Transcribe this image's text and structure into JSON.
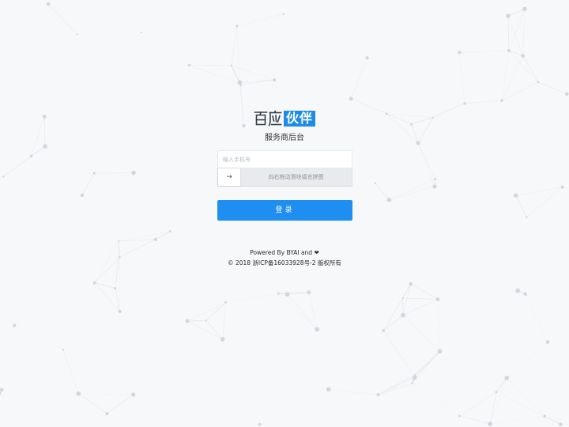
{
  "logo": {
    "part_a": "百应",
    "part_b": "伙伴",
    "accent_color": "#1e8ce6"
  },
  "subtitle": "服务商后台",
  "phone_input": {
    "placeholder": "输入手机号",
    "value": ""
  },
  "slider_captcha": {
    "handle_icon": "arrow-right-icon",
    "handle_glyph": "→",
    "hint": "向右拖动滑块填充拼图"
  },
  "login_button": {
    "label": "登录",
    "color": "#1e8ef0"
  },
  "footer": {
    "powered_by": "Powered By BYAI and",
    "heart_glyph": "❤",
    "heart_icon": "heart-icon",
    "copyright": "© 2018 浙ICP备16033928号-2 版权所有"
  },
  "background": {
    "style": "particle-network",
    "color": "#f6f8fa",
    "line_color": "#d5dae0"
  }
}
